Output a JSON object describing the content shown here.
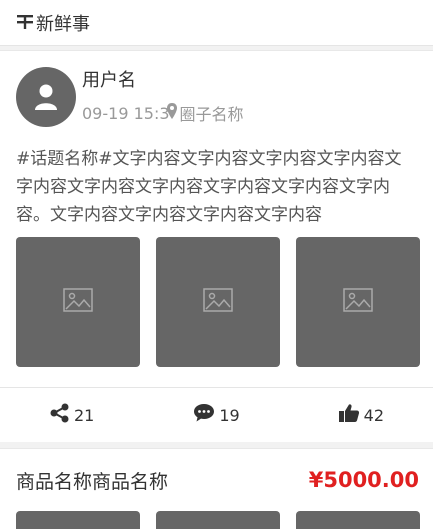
{
  "header": {
    "title": "新鲜事",
    "icon": "news-icon"
  },
  "post": {
    "username": "用户名",
    "time": "09-19 15:3",
    "circle": "圈子名称",
    "content": "#话题名称#文字内容文字内容文字内容文字内容文字内容文字内容文字内容文字内容文字内容文字内容。文字内容文字内容文字内容文字内容",
    "images": [
      "image-placeholder-icon",
      "image-placeholder-icon",
      "image-placeholder-icon"
    ],
    "actions": {
      "share": "21",
      "comment": "19",
      "like": "42"
    }
  },
  "goods": {
    "name": "商品名称商品名称",
    "price": "¥5000.00"
  },
  "colors": {
    "price": "#e02020",
    "placeholder": "#666666"
  }
}
